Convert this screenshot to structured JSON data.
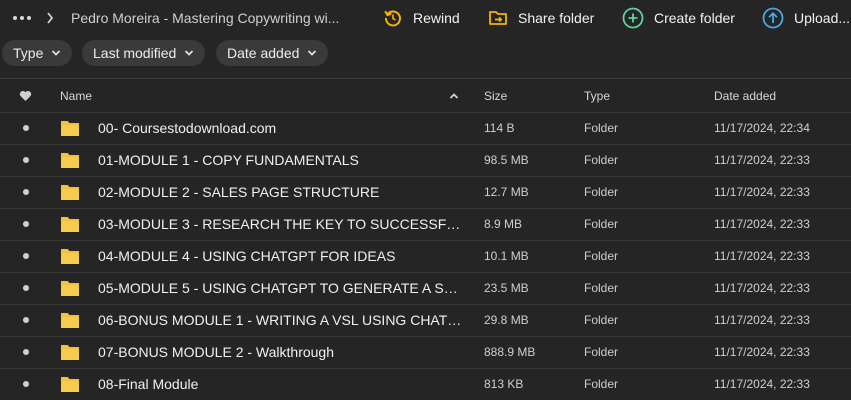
{
  "toolbar": {
    "breadcrumb_title": "Pedro Moreira - Mastering Copywriting wi...",
    "more_icon": "more-horizontal-icon",
    "chevron_icon": "chevron-right-icon",
    "actions": [
      {
        "label": "Rewind",
        "icon": "rewind-icon",
        "color": "#f5b400"
      },
      {
        "label": "Share folder",
        "icon": "share-folder-icon",
        "color": "#f5b400"
      },
      {
        "label": "Create folder",
        "icon": "create-folder-icon",
        "color": "#5fd1a1"
      },
      {
        "label": "Upload...",
        "icon": "upload-icon",
        "color": "#4aa8e6"
      }
    ]
  },
  "filters": [
    {
      "label": "Type"
    },
    {
      "label": "Last modified"
    },
    {
      "label": "Date added"
    }
  ],
  "table": {
    "columns": {
      "favorite_icon": "heart-icon",
      "name": "Name",
      "size": "Size",
      "type": "Type",
      "date_added": "Date added"
    },
    "sort": {
      "column": "name",
      "direction": "ascending"
    },
    "rows": [
      {
        "name": "00- Coursestodownload.com",
        "size": "114 B",
        "type": "Folder",
        "date_added": "11/17/2024, 22:34"
      },
      {
        "name": "01-MODULE 1 - COPY FUNDAMENTALS",
        "size": "98.5 MB",
        "type": "Folder",
        "date_added": "11/17/2024, 22:33"
      },
      {
        "name": "02-MODULE 2 - SALES PAGE STRUCTURE",
        "size": "12.7 MB",
        "type": "Folder",
        "date_added": "11/17/2024, 22:33"
      },
      {
        "name": "03-MODULE 3 - RESEARCH THE KEY TO SUCCESSFUL ...",
        "size": "8.9 MB",
        "type": "Folder",
        "date_added": "11/17/2024, 22:33"
      },
      {
        "name": "04-MODULE 4 - USING CHATGPT FOR IDEAS",
        "size": "10.1 MB",
        "type": "Folder",
        "date_added": "11/17/2024, 22:33"
      },
      {
        "name": "05-MODULE 5 - USING CHATGPT TO GENERATE A SAL...",
        "size": "23.5 MB",
        "type": "Folder",
        "date_added": "11/17/2024, 22:33"
      },
      {
        "name": "06-BONUS MODULE 1 - WRITING A VSL USING CHATG...",
        "size": "29.8 MB",
        "type": "Folder",
        "date_added": "11/17/2024, 22:33"
      },
      {
        "name": "07-BONUS MODULE 2 - Walkthrough",
        "size": "888.9 MB",
        "type": "Folder",
        "date_added": "11/17/2024, 22:33"
      },
      {
        "name": "08-Final Module",
        "size": "813 KB",
        "type": "Folder",
        "date_added": "11/17/2024, 22:33"
      }
    ]
  },
  "colors": {
    "background": "#252525",
    "folder": "#f3c13a",
    "chip": "#3a3a3a"
  }
}
